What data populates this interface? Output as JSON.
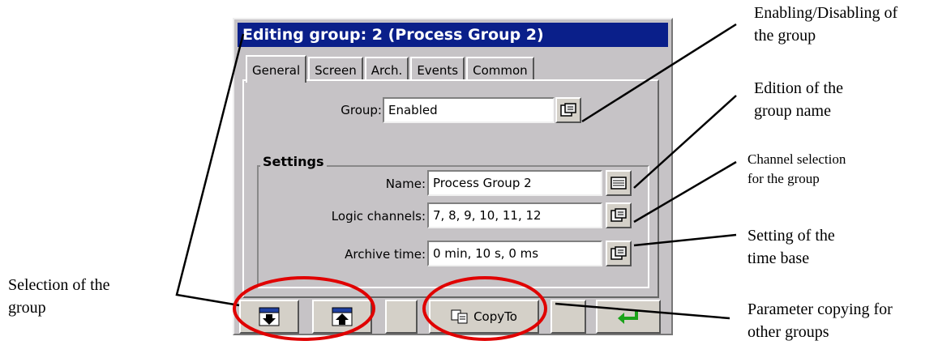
{
  "window": {
    "title": "Editing group: 2 (Process Group 2)"
  },
  "tabs": [
    {
      "label": "General",
      "active": true
    },
    {
      "label": "Screen",
      "active": false
    },
    {
      "label": "Arch.",
      "active": false
    },
    {
      "label": "Events",
      "active": false
    },
    {
      "label": "Common",
      "active": false
    }
  ],
  "general": {
    "group_label": "Group:",
    "group_value": "Enabled",
    "settings_title": "Settings",
    "name_label": "Name:",
    "name_value": "Process Group 2",
    "logic_label": "Logic channels:",
    "logic_value": "7, 8, 9, 10, 11, 12",
    "archive_label": "Archive time:",
    "archive_value": "0 min, 10 s, 0 ms"
  },
  "toolbar": {
    "copyto_label": "CopyTo"
  },
  "annotations": {
    "enable_line1": "Enabling/Disabling of",
    "enable_line2": "the  group",
    "edition_line1": "Edition of the",
    "edition_line2": "group name",
    "channel_line1": "Channel selection",
    "channel_line2": "for the group",
    "timebase_line1": "Setting of the",
    "timebase_line2": " time base",
    "selection_line1": "Selection of the",
    "selection_line2": "group",
    "copy_line1": "Parameter copying  for",
    "copy_line2": "other groups"
  },
  "colors": {
    "titlebar": "#0a1f8a",
    "window_bg": "#c6c3c6",
    "highlight_ellipse": "#e00000",
    "ok_arrow": "#1aa31a"
  },
  "icons": [
    "keyboard-icon",
    "list-select-icon",
    "arrow-down-icon",
    "arrow-up-icon",
    "copy-icon",
    "enter-arrow-icon"
  ]
}
